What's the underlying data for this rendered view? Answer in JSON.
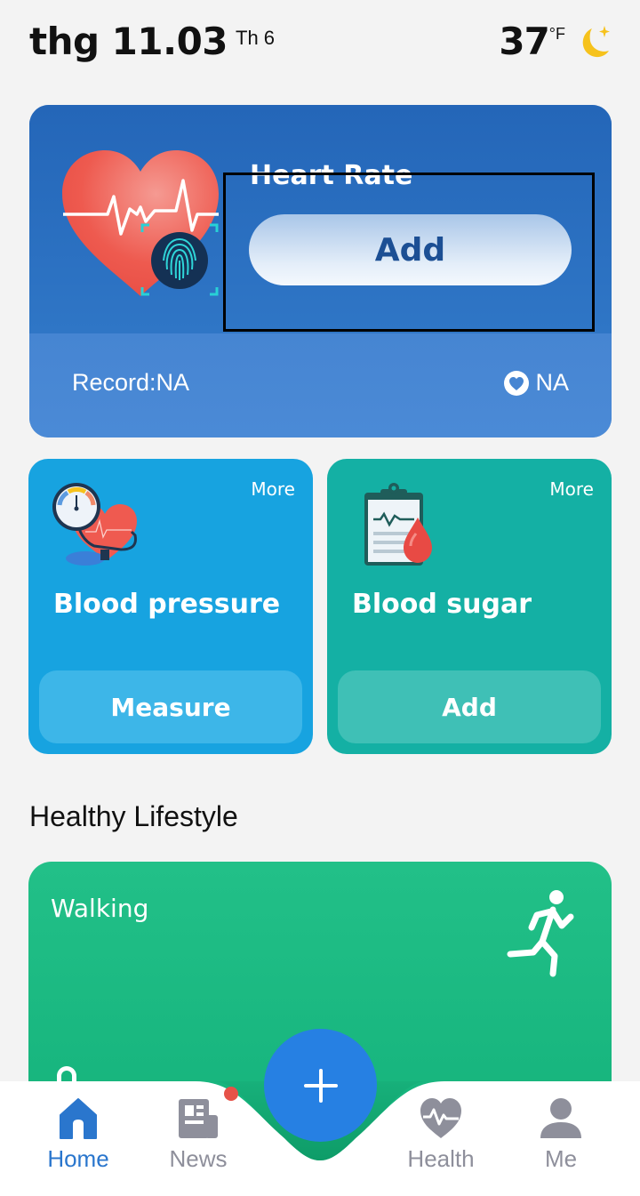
{
  "header": {
    "date": "thg 11.03",
    "weekday": "Th 6",
    "temperature": "37",
    "temperature_unit": "°F",
    "weather_icon": "moon-star-icon"
  },
  "heart_rate": {
    "title": "Heart Rate",
    "add_label": "Add",
    "record_label": "Record:NA",
    "current_value": "NA",
    "colors": {
      "card_top": "#2466b8",
      "card_bottom": "#4b8ad6",
      "button_text": "#1c4f94"
    }
  },
  "cards": [
    {
      "id": "blood-pressure",
      "title": "Blood pressure",
      "more_label": "More",
      "action_label": "Measure",
      "color": "#17a3e0"
    },
    {
      "id": "blood-sugar",
      "title": "Blood sugar",
      "more_label": "More",
      "action_label": "Add",
      "color": "#14b0a4"
    }
  ],
  "lifestyle": {
    "section_title": "Healthy Lifestyle",
    "walking_title": "Walking",
    "color": "#1cb983"
  },
  "nav": {
    "items": [
      {
        "label": "Home",
        "icon": "home-icon",
        "active": true
      },
      {
        "label": "News",
        "icon": "newspaper-icon",
        "active": false,
        "has_badge": true
      },
      {
        "label": "Health",
        "icon": "heart-pulse-icon",
        "active": false
      },
      {
        "label": "Me",
        "icon": "person-icon",
        "active": false
      }
    ],
    "fab_icon": "plus-icon",
    "active_color": "#2a76cd",
    "inactive_color": "#8e8f9b",
    "fab_color": "#2680e3"
  }
}
